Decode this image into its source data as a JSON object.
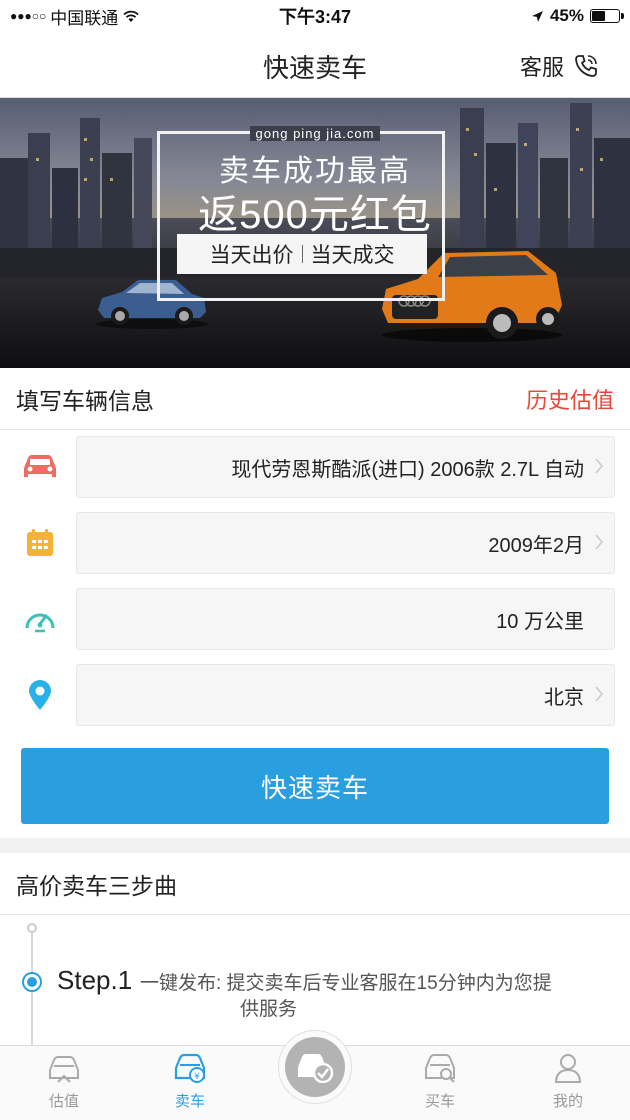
{
  "status_bar": {
    "carrier": "中国联通",
    "time": "下午3:47",
    "battery": "45%",
    "battery_level": 0.45
  },
  "nav": {
    "title": "快速卖车",
    "service_label": "客服"
  },
  "banner": {
    "site": "gong ping jia.com",
    "headline1": "卖车成功最高",
    "headline2": "返500元红包",
    "tag_left": "当天出价",
    "tag_right": "当天成交"
  },
  "vehicle_section": {
    "title": "填写车辆信息",
    "history_link": "历史估值"
  },
  "form": {
    "model": "现代劳恩斯酷派(进口) 2006款 2.7L 自动",
    "reg_date": "2009年2月",
    "mileage": "10 万公里",
    "city": "北京"
  },
  "submit_label": "快速卖车",
  "steps_section": {
    "title": "高价卖车三步曲",
    "step1_name": "Step.1",
    "step1_desc_line1": "一键发布: 提交卖车后专业客服在15分钟内为您提",
    "step1_desc_line2": "供服务"
  },
  "tabs": {
    "valuation": "估值",
    "sell": "卖车",
    "buy": "买车",
    "mine": "我的"
  },
  "colors": {
    "accent": "#2a9fe0",
    "link_red": "#e8473b",
    "car_icon": "#f06a64",
    "calendar_icon": "#f5b335",
    "speed_icon": "#3cc1b4",
    "location_icon": "#2ab0e8"
  }
}
